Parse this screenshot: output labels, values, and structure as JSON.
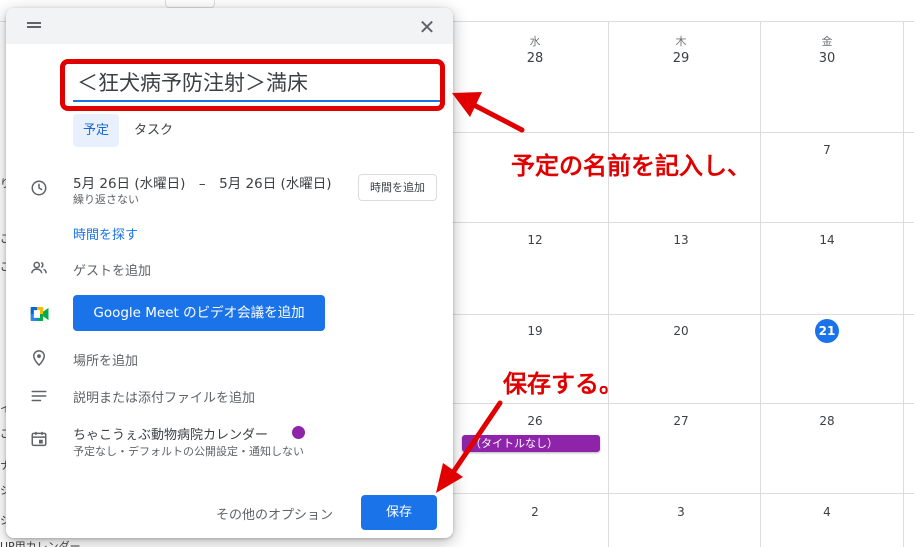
{
  "calendar": {
    "weekdays": [
      "水",
      "木",
      "金"
    ],
    "weeks": [
      [
        "28",
        "29",
        "30"
      ],
      [
        "",
        "",
        "7"
      ],
      [
        "12",
        "13",
        "14"
      ],
      [
        "19",
        "20",
        "21"
      ],
      [
        "26",
        "27",
        "28"
      ],
      [
        "2",
        "3",
        "4"
      ]
    ],
    "today": "21",
    "event_label": "（タイトルなし）",
    "bottom_fragment": "UP用カレンダー",
    "sidebar_fragments": [
      "り",
      "ご",
      "ご",
      "イ",
      "ご",
      "ナ",
      "ジ",
      "ジ"
    ]
  },
  "dialog": {
    "close_symbol": "✕",
    "title_value": "＜狂犬病予防注射＞満床",
    "tabs": [
      {
        "label": "予定",
        "active": true
      },
      {
        "label": "タスク",
        "active": false
      }
    ],
    "date_range": "5月 26日 (水曜日)　–　5月 26日 (水曜日)",
    "repeat": "繰り返さない",
    "add_time_label": "時間を追加",
    "find_time_label": "時間を探す",
    "guests_label": "ゲストを追加",
    "meet_button_label": "Google Meet のビデオ会議を追加",
    "location_label": "場所を追加",
    "description_label": "説明または添付ファイルを追加",
    "calendar_name": "ちゃこうぇぶ動物病院カレンダー",
    "calendar_sub": "予定なし・デフォルトの公開設定・通知しない",
    "more_options_label": "その他のオプション",
    "save_label": "保存"
  },
  "annotations": {
    "note_name": "予定の名前を記入し、",
    "note_save": "保存する。"
  },
  "colors": {
    "accent": "#1a73e8",
    "calendar_purple": "#8e24aa",
    "annotation_red": "#e00000"
  }
}
